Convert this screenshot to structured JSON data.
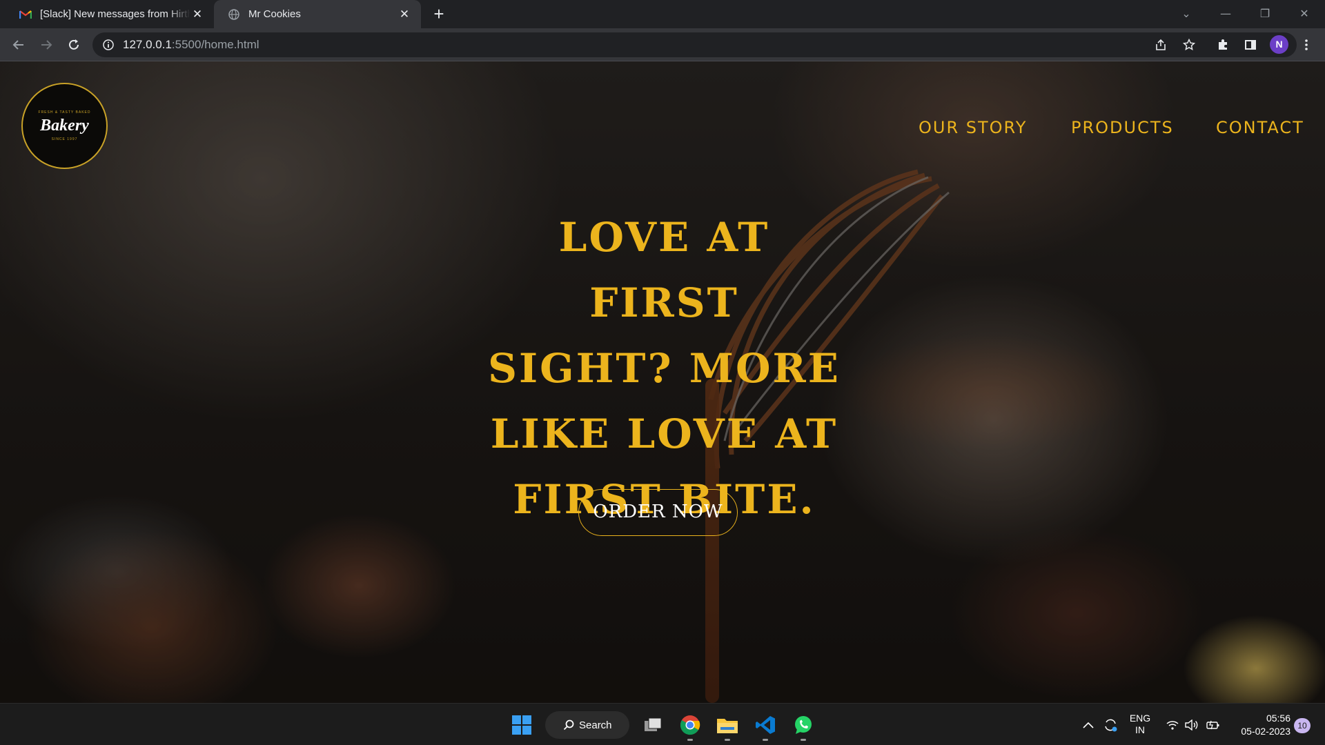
{
  "browser": {
    "tabs": [
      {
        "title": "[Slack] New messages from Hirthi",
        "favicon": "gmail-icon",
        "active": false
      },
      {
        "title": "Mr Cookies",
        "favicon": "globe-icon",
        "active": true
      }
    ],
    "url": {
      "host": "127.0.0.1",
      "path": ":5500/home.html"
    },
    "profile_initial": "N"
  },
  "site": {
    "logo": {
      "top": "FRESH & TASTY BAKED",
      "word": "Bakery",
      "since": "SINCE 1997"
    },
    "nav": [
      "OUR STORY",
      "PRODUCTS",
      "CONTACT"
    ],
    "hero_lines": [
      "LOVE AT FIRST",
      "SIGHT? MORE",
      "LIKE LOVE AT",
      "FIRST BITE."
    ],
    "cta": "ORDER NOW",
    "colors": {
      "accent": "#ecb41d",
      "cta_text": "#ffffff"
    }
  },
  "taskbar": {
    "search_label": "Search",
    "apps": [
      "windows-start-icon",
      "task-view-icon",
      "chrome-icon",
      "file-explorer-icon",
      "vscode-icon",
      "whatsapp-icon"
    ],
    "lang": [
      "ENG",
      "IN"
    ],
    "time": "05:56",
    "date": "05-02-2023",
    "notification_count": "10"
  }
}
